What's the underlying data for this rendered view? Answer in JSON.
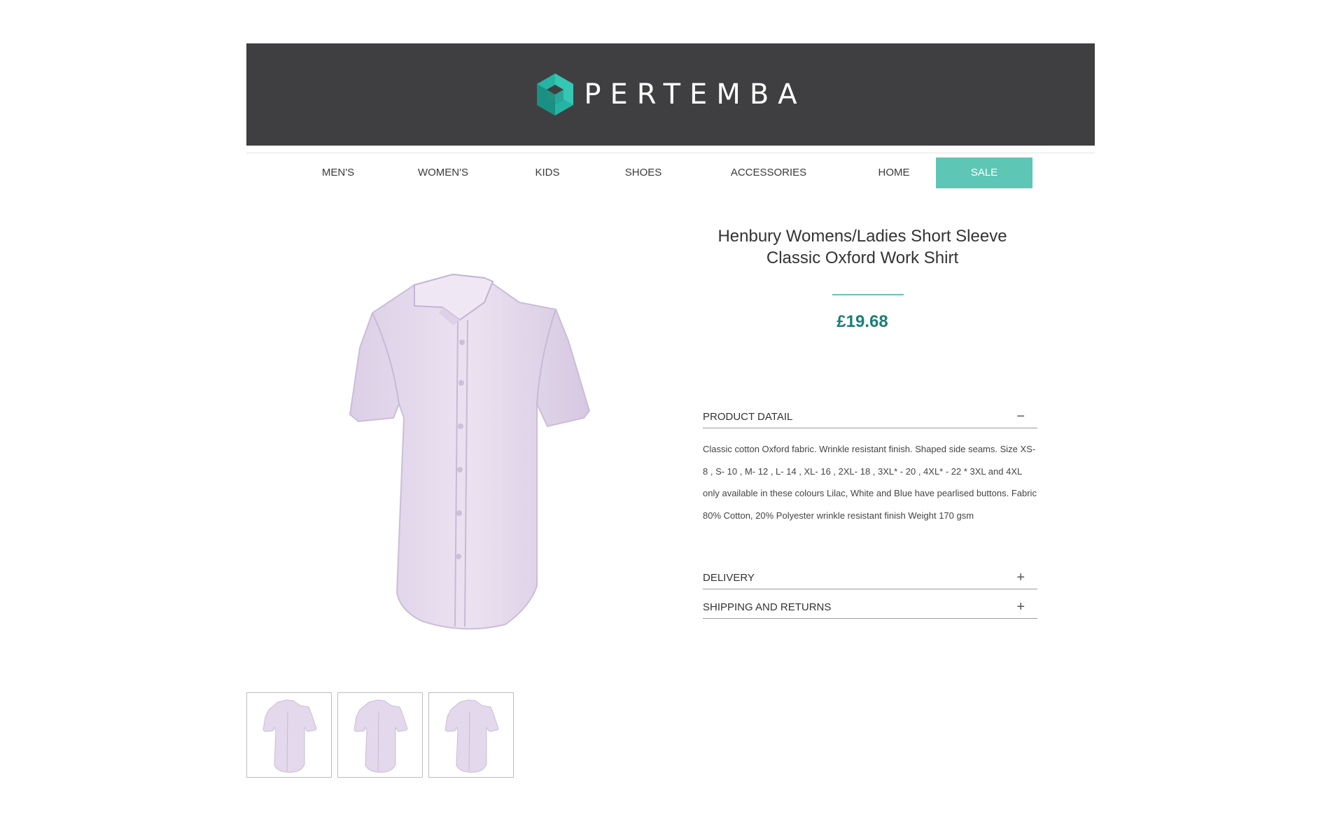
{
  "header": {
    "brand": "PERTEMBA",
    "logo_icon": "hexagon-cube-icon",
    "background": "#3f3f41"
  },
  "nav": {
    "items": [
      {
        "label": "MEN'S"
      },
      {
        "label": "WOMEN'S"
      },
      {
        "label": "KIDS"
      },
      {
        "label": "SHOES"
      },
      {
        "label": "ACCESSORIES"
      },
      {
        "label": "HOME"
      },
      {
        "label": "SALE"
      }
    ],
    "active_color": "#5ec6b5"
  },
  "product": {
    "title_line1": "Henbury Womens/Ladies Short Sleeve",
    "title_line2": "Classic Oxford Work Shirt",
    "price": "£19.68",
    "price_color": "#1c7e76",
    "image_alt": "lilac short sleeve oxford shirt",
    "shirt_color": "#e4d9ec"
  },
  "accordion": {
    "product_detail": {
      "label": "PRODUCT DATAIL",
      "toggle": "−",
      "text": "Classic cotton Oxford fabric. Wrinkle resistant finish. Shaped side seams. Size XS- 8 , S- 10 , M- 12 , L- 14 , XL- 16 , 2XL- 18 , 3XL* - 20 , 4XL* - 22 * 3XL and 4XL only available in these colours Lilac, White and Blue have pearlised buttons. Fabric 80% Cotton, 20% Polyester wrinkle resistant finish Weight 170 gsm"
    },
    "delivery": {
      "label": "DELIVERY",
      "toggle": "+"
    },
    "shipping": {
      "label": "SHIPPING AND RETURNS",
      "toggle": "+"
    }
  },
  "thumbnails": [
    {
      "alt": "shirt thumbnail 1"
    },
    {
      "alt": "shirt thumbnail 2"
    },
    {
      "alt": "shirt thumbnail 3"
    }
  ]
}
